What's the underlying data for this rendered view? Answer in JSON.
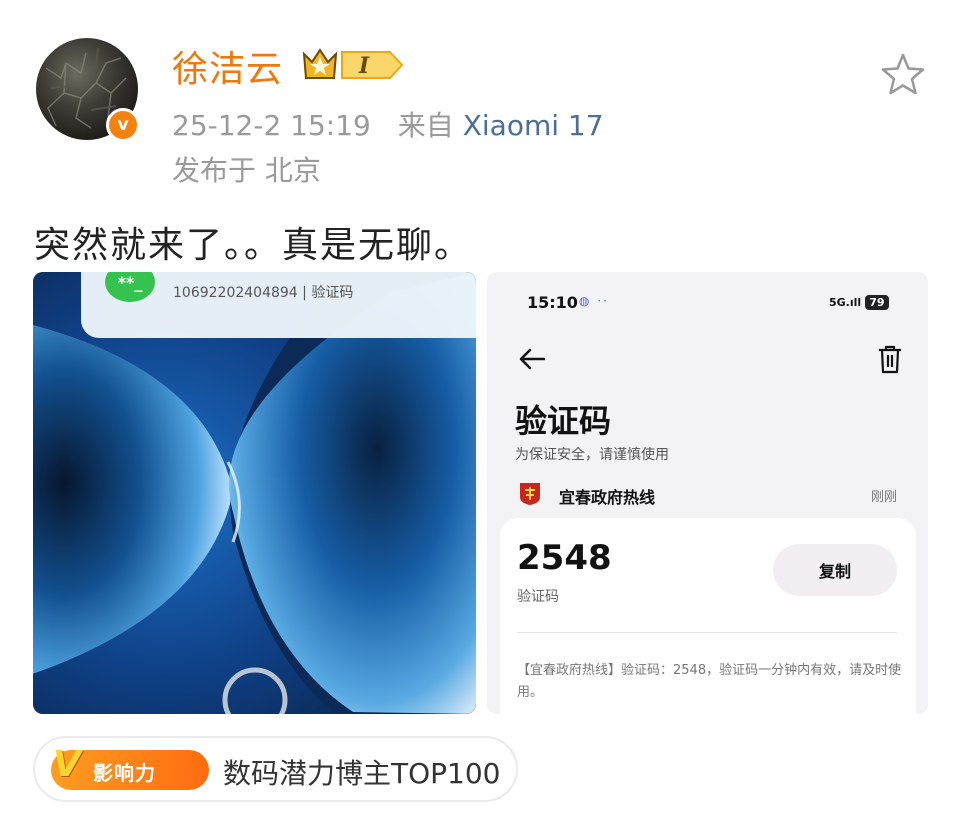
{
  "post": {
    "username": "徐洁云",
    "crown_level": "I",
    "date": "25-12-2 15:19",
    "source_prefix": "来自",
    "device": "Xiaomi 17",
    "location": "发布于 北京",
    "text": "突然就来了。。真是无聊。",
    "verified_mark": "v"
  },
  "left_image": {
    "notification_icon_text": "**_",
    "notification_title": "****",
    "notification_sub": "10692202404894 | 验证码"
  },
  "right_image": {
    "status_time": "15:10",
    "status_icons": "◍ ··",
    "signal": "5G.ıll",
    "battery": "79",
    "title": "验证码",
    "subtitle": "为保证安全，请谨慎使用",
    "sender": "宜春政府热线",
    "sender_time": "刚刚",
    "code": "2548",
    "code_label": "验证码",
    "copy_label": "复制",
    "body": "【宜春政府热线】验证码：2548，验证码一分钟内有效，请及时使用。"
  },
  "badge": {
    "icon_letter": "V",
    "icon_text": "影响力",
    "text": "数码潜力博主TOP100"
  },
  "colors": {
    "username": "#f0770c",
    "device_link": "#4a6f99",
    "verified": "#f5820f"
  }
}
